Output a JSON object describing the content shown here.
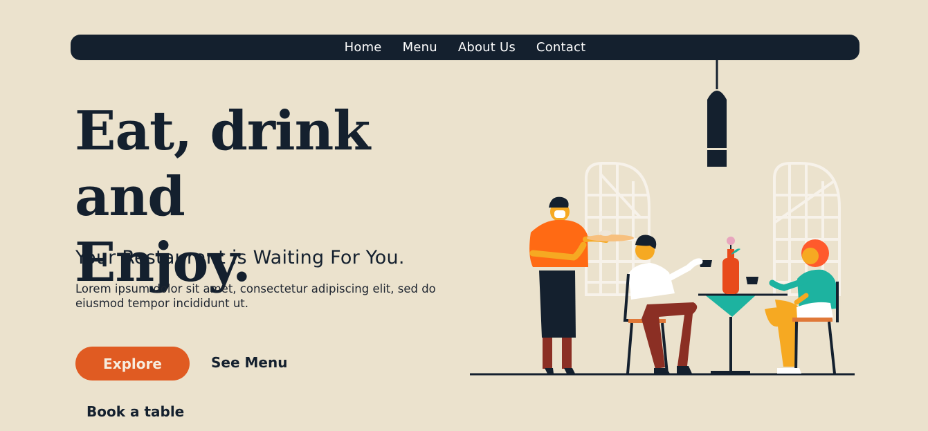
{
  "nav": {
    "items": [
      {
        "label": "Home"
      },
      {
        "label": "Menu"
      },
      {
        "label": "About Us"
      },
      {
        "label": "Contact"
      }
    ]
  },
  "hero": {
    "title_line1": "Eat, drink and",
    "title_line2": "Enjoy.",
    "subtitle": "Your Restaurant is Waiting For You.",
    "description": "Lorem ipsum dolor sit amet, consectetur adipiscing elit, sed do eiusmod tempor incididunt ut.",
    "primary_button": "Explore",
    "secondary_link": "See Menu",
    "tertiary_link": "Book a table"
  },
  "colors": {
    "background": "#ebe2cd",
    "nav_bg": "#14202e",
    "accent": "#e05b22",
    "text_dark": "#14202e"
  },
  "illustration": {
    "semantic": "restaurant-scene-illustration"
  }
}
